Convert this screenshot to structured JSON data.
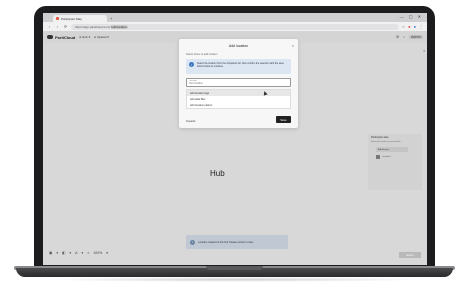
{
  "browser": {
    "tab_title": "Participant Map",
    "new_tab": "+",
    "window_controls": "— ▢ ✕",
    "back": "‹",
    "forward": "›",
    "reload": "⟳",
    "url_prefix": "https://app.particloud.com/",
    "url_highlight": "hub/location",
    "extensions": [
      "☆",
      "●",
      "●",
      "⋮"
    ]
  },
  "app": {
    "logo_text": "PartiCloud",
    "nav": [
      "Hub",
      "Upload"
    ],
    "user_badge": "Admin",
    "hub_label": "Hub"
  },
  "right_panel": {
    "title": "Participant data",
    "text": "Select the location to view details",
    "button": "Add location",
    "item": "Location 1"
  },
  "banner": {
    "icon": "i",
    "text": "Location created for this hub. Please refresh to view."
  },
  "bottom_toolbar": [
    "▣",
    "▾",
    "◧",
    "▾",
    "A",
    "▾",
    "≡",
    "100%",
    "▾"
  ],
  "zoom_chip": "Export",
  "modal": {
    "title": "Add location",
    "close": "×",
    "subtitle": "Select where to add location",
    "info_icon": "i",
    "info_text": "Select the location from the dropdown list, then confirm the selection with the save button below to continue.",
    "field_label": "Location",
    "field_value": "Hub location",
    "options": [
      "Add location tags",
      "Add data filter",
      "Add location pattern"
    ],
    "cancel_label": "Cancel",
    "save_label": "Save"
  }
}
